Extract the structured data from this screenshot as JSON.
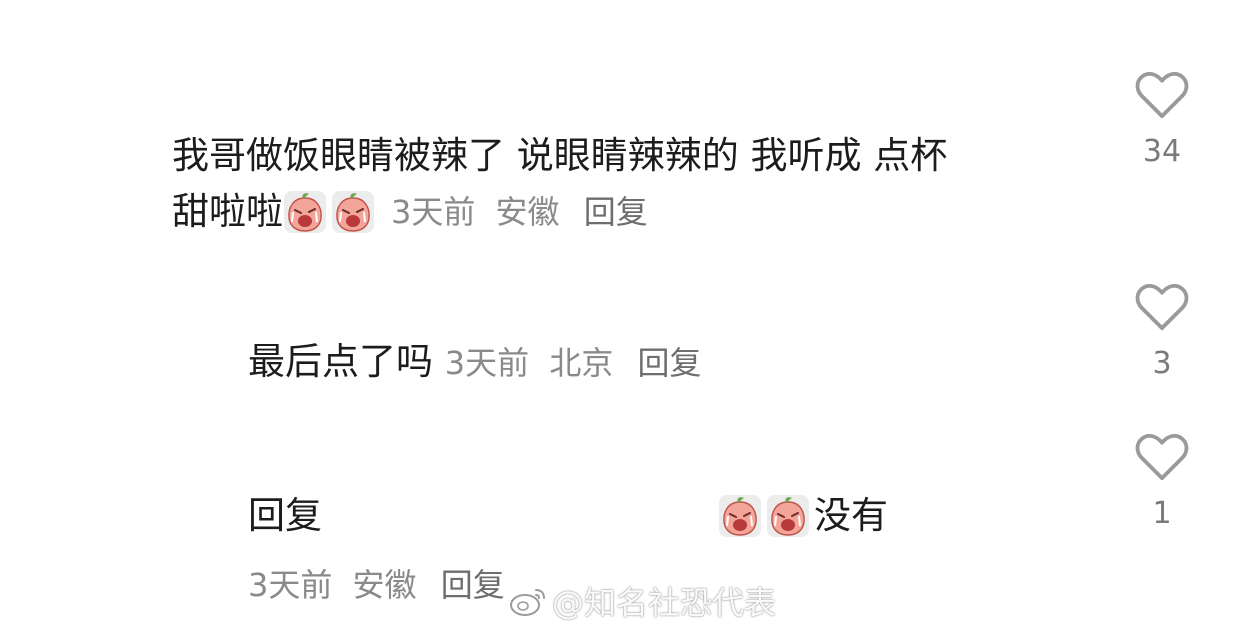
{
  "comments": [
    {
      "text_line1": "我哥做饭眼睛被辣了 说眼睛辣辣的 我听成 点杯",
      "text_line2": "甜啦啦",
      "time": "3天前",
      "location": "安徽",
      "reply_label": "回复",
      "likes": "34",
      "emojis": [
        "crying-peach-emoji",
        "crying-peach-emoji"
      ]
    },
    {
      "text": "最后点了吗",
      "time": "3天前",
      "location": "北京",
      "reply_label": "回复",
      "likes": "3"
    },
    {
      "text_prefix": "回复",
      "text_suffix": "没有",
      "time": "3天前",
      "location": "安徽",
      "reply_label": "回复",
      "likes": "1",
      "emojis": [
        "crying-peach-emoji",
        "crying-peach-emoji"
      ]
    }
  ],
  "watermark": {
    "text": "@知名社恐代表",
    "icon": "weibo-icon"
  },
  "colors": {
    "text": "#1c1c1c",
    "meta": "#8a8a8a",
    "like_icon": "#9a9a9a"
  }
}
